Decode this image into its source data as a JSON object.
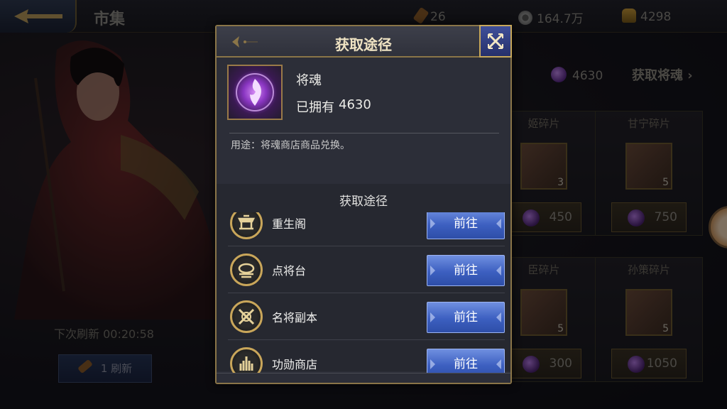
{
  "topbar": {
    "title": "市集",
    "resources": [
      {
        "icon": "torch-icon",
        "value": "26"
      },
      {
        "icon": "coin-icon",
        "value": "164.7万"
      },
      {
        "icon": "gold-ingot-icon",
        "value": "4298"
      }
    ]
  },
  "left": {
    "refresh_timer": "下次刷新 00:20:58",
    "refresh_button": {
      "count": "1",
      "label": "刷新"
    }
  },
  "shop": {
    "soul_count": "4630",
    "get_soul_link": "获取将魂",
    "cards": [
      {
        "title": "姬碎片",
        "count": "3",
        "price": "450"
      },
      {
        "title": "甘宁碎片",
        "count": "5",
        "price": "750"
      },
      {
        "title": "臣碎片",
        "count": "5",
        "price": "300"
      },
      {
        "title": "孙策碎片",
        "count": "5",
        "price": "1050"
      }
    ]
  },
  "popup": {
    "title": "获取途径",
    "item": {
      "name": "将魂",
      "owned_label": "已拥有",
      "owned_value": "4630",
      "usage": "用途：将魂商店商品兑换。"
    },
    "sources_title": "获取途径",
    "sources": [
      {
        "name": "重生阁",
        "icon": "rebirth-pavilion-icon",
        "button": "前往"
      },
      {
        "name": "点将台",
        "icon": "general-platform-icon",
        "button": "前往"
      },
      {
        "name": "名将副本",
        "icon": "crossed-swords-icon",
        "button": "前往"
      },
      {
        "name": "功勋商店",
        "icon": "merit-shop-icon",
        "button": "前往"
      }
    ]
  },
  "colors": {
    "popup_border": "#8a7548",
    "go_button": "#3c5fc0",
    "title_text": "#efe3c3"
  }
}
